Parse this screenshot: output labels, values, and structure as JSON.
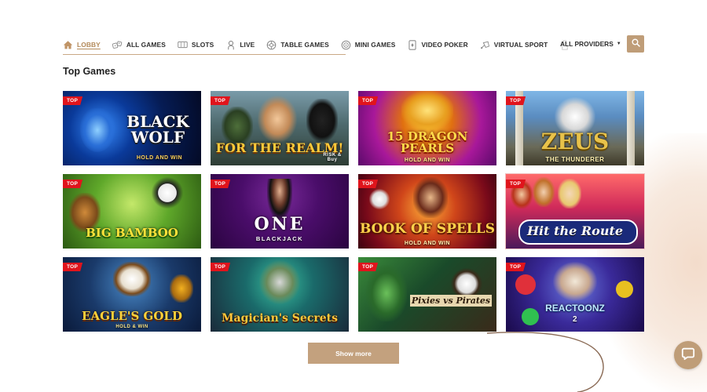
{
  "nav": {
    "items": [
      {
        "label": "LOBBY",
        "icon": "home-icon",
        "active": true
      },
      {
        "label": "ALL GAMES",
        "icon": "dice-icon"
      },
      {
        "label": "SLOTS",
        "icon": "slot-machine-icon"
      },
      {
        "label": "LIVE",
        "icon": "live-dealer-icon"
      },
      {
        "label": "TABLE GAMES",
        "icon": "roulette-icon"
      },
      {
        "label": "MINI GAMES",
        "icon": "mini-games-icon"
      },
      {
        "label": "VIDEO POKER",
        "icon": "playing-card-icon"
      },
      {
        "label": "VIRTUAL SPORT",
        "icon": "virtual-sport-icon"
      }
    ],
    "providers_label": "ALL PROVIDERS",
    "search_icon": "search-icon"
  },
  "section": {
    "title": "Top Games"
  },
  "badge_label": "TOP",
  "games": [
    {
      "title": "BLACK WOLF",
      "subtitle": "HOLD AND WIN"
    },
    {
      "title": "FOR THE REALM!",
      "subtitle": "RISK & Buy"
    },
    {
      "title": "15 DRAGON PEARLS",
      "subtitle": "HOLD AND WIN"
    },
    {
      "title": "ZEUS",
      "subtitle": "THE THUNDERER"
    },
    {
      "title": "BIG BAMBOO",
      "subtitle": ""
    },
    {
      "title": "ONE",
      "subtitle": "BLACKJACK"
    },
    {
      "title": "BOOK OF SPELLS",
      "subtitle": "HOLD AND WIN"
    },
    {
      "title": "Hit the Route",
      "subtitle": ""
    },
    {
      "title": "EAGLE'S GOLD",
      "subtitle": "HOLD & WIN"
    },
    {
      "title": "Magician's Secrets",
      "subtitle": ""
    },
    {
      "title": "Pixies vs Pirates",
      "subtitle": ""
    },
    {
      "title": "REACTOONZ",
      "subtitle": "2"
    }
  ],
  "show_more_label": "Show more",
  "colors": {
    "accent": "#bf9d78",
    "badge": "#e0141c",
    "active_nav": "#b38a5a"
  }
}
